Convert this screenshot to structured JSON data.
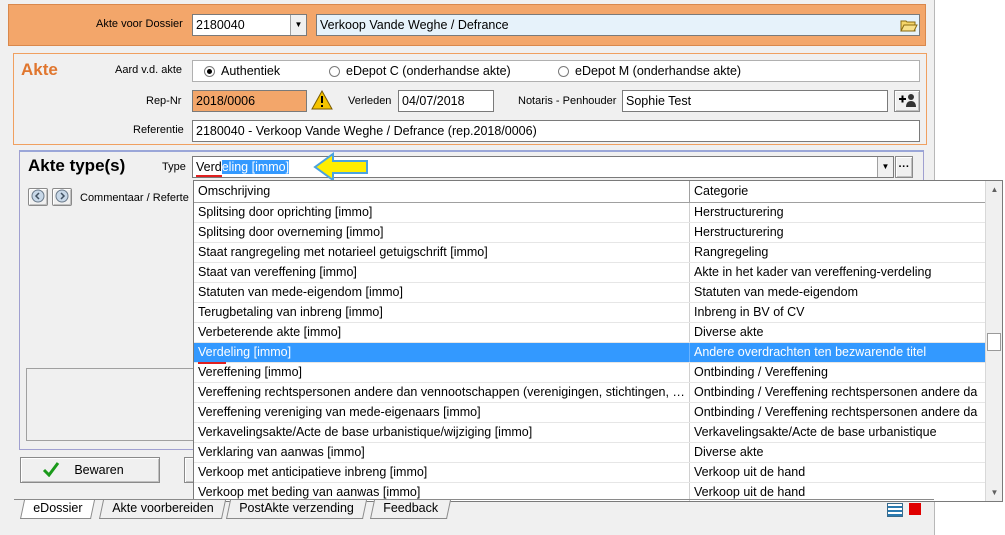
{
  "dossier": {
    "label": "Akte voor Dossier",
    "number": "2180040",
    "name": "Verkoop Vande Weghe / Defrance"
  },
  "akte": {
    "title": "Akte",
    "aard_label": "Aard v.d. akte",
    "options": [
      "Authentiek",
      "eDepot C (onderhandse akte)",
      "eDepot M (onderhandse akte)"
    ],
    "selected_option": 0,
    "repnr_label": "Rep-Nr",
    "repnr_value": "2018/0006",
    "verleden_label": "Verleden",
    "verleden_value": "04/07/2018",
    "notaris_label": "Notaris - Penhouder",
    "notaris_value": "Sophie Test",
    "referentie_label": "Referentie",
    "referentie_value": "2180040 - Verkoop Vande Weghe / Defrance (rep.2018/0006)"
  },
  "akte_types": {
    "title": "Akte type(s)",
    "type_label": "Type",
    "type_typed": "Verd",
    "type_autocomplete": "eling [immo]",
    "commentaar_label": "Commentaar / Referte",
    "save_label": "Bewaren"
  },
  "list": {
    "headers": [
      "Omschrijving",
      "Categorie"
    ],
    "selected_index": 7,
    "rows": [
      [
        "Splitsing door oprichting [immo]",
        "Herstructurering"
      ],
      [
        "Splitsing door overneming [immo]",
        "Herstructurering"
      ],
      [
        "Staat rangregeling met notarieel getuigschrift [immo]",
        "Rangregeling"
      ],
      [
        "Staat van vereffening [immo]",
        "Akte in het kader van vereffening-verdeling"
      ],
      [
        "Statuten van mede-eigendom [immo]",
        "Statuten van mede-eigendom"
      ],
      [
        "Terugbetaling van inbreng [immo]",
        "Inbreng in BV of CV"
      ],
      [
        "Verbeterende akte [immo]",
        "Diverse akte"
      ],
      [
        "Verdeling [immo]",
        "Andere overdrachten ten bezwarende titel"
      ],
      [
        "Vereffening [immo]",
        "Ontbinding / Vereffening"
      ],
      [
        "Vereffening rechtspersonen andere dan vennootschappen (verenigingen, stichtingen, …",
        "Ontbinding / Vereffening rechtspersonen andere da"
      ],
      [
        "Vereffening vereniging van mede-eigenaars [immo]",
        "Ontbinding / Vereffening rechtspersonen andere da"
      ],
      [
        "Verkavelingsakte/Acte de base urbanistique/wijziging [immo]",
        "Verkavelingsakte/Acte de base urbanistique"
      ],
      [
        "Verklaring van aanwas [immo]",
        "Diverse akte"
      ],
      [
        "Verkoop met anticipatieve inbreng [immo]",
        "Verkoop uit de hand"
      ],
      [
        "Verkoop met beding van aanwas [immo]",
        "Verkoop uit de hand"
      ]
    ]
  },
  "tabs": [
    "eDossier",
    "Akte voorbereiden",
    "PostAkte verzending",
    "Feedback"
  ],
  "colors": {
    "accent_orange": "#f3a66a",
    "title_orange": "#e0762e",
    "selection_blue": "#3399ff",
    "arrow_yellow": "#ffee00"
  }
}
